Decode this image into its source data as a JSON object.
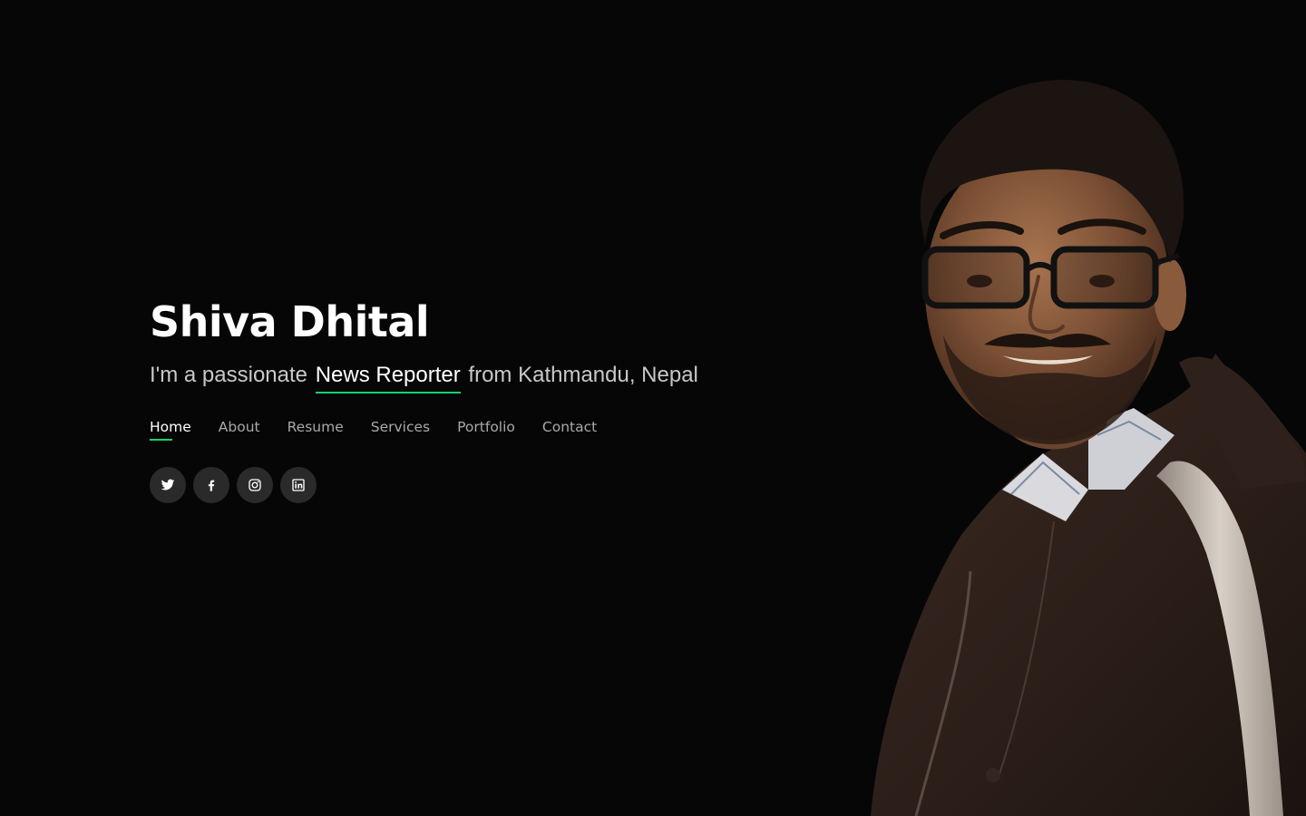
{
  "hero": {
    "name": "Shiva Dhital",
    "tagline_prefix": "I'm a passionate ",
    "role": "News Reporter",
    "tagline_suffix": " from Kathmandu, Nepal"
  },
  "nav": {
    "items": [
      {
        "label": "Home",
        "active": true
      },
      {
        "label": "About",
        "active": false
      },
      {
        "label": "Resume",
        "active": false
      },
      {
        "label": "Services",
        "active": false
      },
      {
        "label": "Portfolio",
        "active": false
      },
      {
        "label": "Contact",
        "active": false
      }
    ]
  },
  "social": {
    "icons": [
      "twitter-icon",
      "facebook-icon",
      "instagram-icon",
      "linkedin-icon"
    ]
  },
  "colors": {
    "background": "#060607",
    "accent": "#18d26e",
    "text_primary": "#ffffff",
    "text_muted": "#a9a9a9",
    "social_button_bg": "#2a2a2b"
  }
}
